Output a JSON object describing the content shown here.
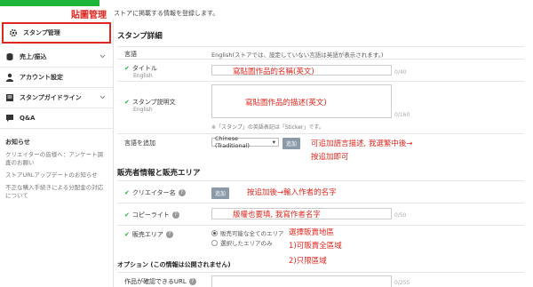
{
  "progress": {
    "fraction": 1.0,
    "color": "#1db53a"
  },
  "annotation_sidebar": "貼圖管理",
  "sidebar": {
    "items": [
      {
        "label": "スタンプ管理",
        "icon": "gear-icon",
        "active": true
      },
      {
        "label": "売上/振込",
        "icon": "database-icon",
        "active": false
      },
      {
        "label": "アカウント設定",
        "icon": "person-icon",
        "active": false
      },
      {
        "label": "スタンプガイドライン",
        "icon": "book-icon",
        "active": false
      },
      {
        "label": "Q&A",
        "icon": "qa-icon",
        "active": false
      }
    ],
    "notice_header": "お知らせ",
    "notices": [
      "クリエイターの皆様へ：アンケート調査のお願い",
      "ストアURLアップデートのお知らせ",
      "不正な購入手続きによる分配金の対応について"
    ]
  },
  "main": {
    "intro": "ストアに掲載する情報を登録します。",
    "detail_section": {
      "title": "スタンプ詳細",
      "language_label": "言語",
      "language_value": "English(ストアでは、設定していない言語は英語が表示されます。)",
      "title_field": {
        "label": "タイトル",
        "sub": "English",
        "counter": "0/40",
        "annotation": "寫貼圖作品的名稱(英文)"
      },
      "desc_field": {
        "label": "スタンプ説明文",
        "sub": "English",
        "counter": "0/160",
        "annotation": "寫貼圖作品的描述(英文)",
        "note": "※「スタンプ」の英語表記は「Sticker」です。"
      },
      "add_language": {
        "label": "言語を追加",
        "select_value": "Chinese (Traditional)",
        "button": "追加",
        "annotation_line1": "可追加語言描述, 我選繁中後→",
        "annotation_line2": "按追加即可"
      }
    },
    "sales_section": {
      "title": "販売者情報と販売エリア",
      "creator": {
        "label": "クリエイター名",
        "button": "追加",
        "annotation": "按追加後→輸入作者的名字"
      },
      "copyright": {
        "label": "コピーライト",
        "counter": "0/50",
        "annotation": "版權也要填, 我寫作者名字"
      },
      "area": {
        "label": "販売エリア",
        "options": [
          "販売可能な全てのエリア",
          "選択したエリアのみ"
        ],
        "selected_index": 0,
        "annotation_lines": [
          "選擇販賣地區",
          "1)可販賣全區域",
          "2)只限區域"
        ]
      }
    },
    "option_section": {
      "title": "オプション (この情報は公開されません)",
      "url_field": {
        "label": "作品が確認できるURL",
        "counter": "0/255"
      }
    }
  }
}
